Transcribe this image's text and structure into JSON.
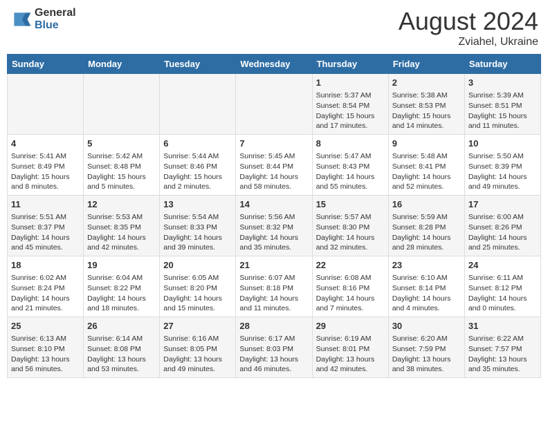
{
  "header": {
    "logo_general": "General",
    "logo_blue": "Blue",
    "month_year": "August 2024",
    "location": "Zviahel, Ukraine"
  },
  "days_of_week": [
    "Sunday",
    "Monday",
    "Tuesday",
    "Wednesday",
    "Thursday",
    "Friday",
    "Saturday"
  ],
  "weeks": [
    [
      {
        "day": "",
        "text": ""
      },
      {
        "day": "",
        "text": ""
      },
      {
        "day": "",
        "text": ""
      },
      {
        "day": "",
        "text": ""
      },
      {
        "day": "1",
        "text": "Sunrise: 5:37 AM\nSunset: 8:54 PM\nDaylight: 15 hours and 17 minutes."
      },
      {
        "day": "2",
        "text": "Sunrise: 5:38 AM\nSunset: 8:53 PM\nDaylight: 15 hours and 14 minutes."
      },
      {
        "day": "3",
        "text": "Sunrise: 5:39 AM\nSunset: 8:51 PM\nDaylight: 15 hours and 11 minutes."
      }
    ],
    [
      {
        "day": "4",
        "text": "Sunrise: 5:41 AM\nSunset: 8:49 PM\nDaylight: 15 hours and 8 minutes."
      },
      {
        "day": "5",
        "text": "Sunrise: 5:42 AM\nSunset: 8:48 PM\nDaylight: 15 hours and 5 minutes."
      },
      {
        "day": "6",
        "text": "Sunrise: 5:44 AM\nSunset: 8:46 PM\nDaylight: 15 hours and 2 minutes."
      },
      {
        "day": "7",
        "text": "Sunrise: 5:45 AM\nSunset: 8:44 PM\nDaylight: 14 hours and 58 minutes."
      },
      {
        "day": "8",
        "text": "Sunrise: 5:47 AM\nSunset: 8:43 PM\nDaylight: 14 hours and 55 minutes."
      },
      {
        "day": "9",
        "text": "Sunrise: 5:48 AM\nSunset: 8:41 PM\nDaylight: 14 hours and 52 minutes."
      },
      {
        "day": "10",
        "text": "Sunrise: 5:50 AM\nSunset: 8:39 PM\nDaylight: 14 hours and 49 minutes."
      }
    ],
    [
      {
        "day": "11",
        "text": "Sunrise: 5:51 AM\nSunset: 8:37 PM\nDaylight: 14 hours and 45 minutes."
      },
      {
        "day": "12",
        "text": "Sunrise: 5:53 AM\nSunset: 8:35 PM\nDaylight: 14 hours and 42 minutes."
      },
      {
        "day": "13",
        "text": "Sunrise: 5:54 AM\nSunset: 8:33 PM\nDaylight: 14 hours and 39 minutes."
      },
      {
        "day": "14",
        "text": "Sunrise: 5:56 AM\nSunset: 8:32 PM\nDaylight: 14 hours and 35 minutes."
      },
      {
        "day": "15",
        "text": "Sunrise: 5:57 AM\nSunset: 8:30 PM\nDaylight: 14 hours and 32 minutes."
      },
      {
        "day": "16",
        "text": "Sunrise: 5:59 AM\nSunset: 8:28 PM\nDaylight: 14 hours and 28 minutes."
      },
      {
        "day": "17",
        "text": "Sunrise: 6:00 AM\nSunset: 8:26 PM\nDaylight: 14 hours and 25 minutes."
      }
    ],
    [
      {
        "day": "18",
        "text": "Sunrise: 6:02 AM\nSunset: 8:24 PM\nDaylight: 14 hours and 21 minutes."
      },
      {
        "day": "19",
        "text": "Sunrise: 6:04 AM\nSunset: 8:22 PM\nDaylight: 14 hours and 18 minutes."
      },
      {
        "day": "20",
        "text": "Sunrise: 6:05 AM\nSunset: 8:20 PM\nDaylight: 14 hours and 15 minutes."
      },
      {
        "day": "21",
        "text": "Sunrise: 6:07 AM\nSunset: 8:18 PM\nDaylight: 14 hours and 11 minutes."
      },
      {
        "day": "22",
        "text": "Sunrise: 6:08 AM\nSunset: 8:16 PM\nDaylight: 14 hours and 7 minutes."
      },
      {
        "day": "23",
        "text": "Sunrise: 6:10 AM\nSunset: 8:14 PM\nDaylight: 14 hours and 4 minutes."
      },
      {
        "day": "24",
        "text": "Sunrise: 6:11 AM\nSunset: 8:12 PM\nDaylight: 14 hours and 0 minutes."
      }
    ],
    [
      {
        "day": "25",
        "text": "Sunrise: 6:13 AM\nSunset: 8:10 PM\nDaylight: 13 hours and 56 minutes."
      },
      {
        "day": "26",
        "text": "Sunrise: 6:14 AM\nSunset: 8:08 PM\nDaylight: 13 hours and 53 minutes."
      },
      {
        "day": "27",
        "text": "Sunrise: 6:16 AM\nSunset: 8:05 PM\nDaylight: 13 hours and 49 minutes."
      },
      {
        "day": "28",
        "text": "Sunrise: 6:17 AM\nSunset: 8:03 PM\nDaylight: 13 hours and 46 minutes."
      },
      {
        "day": "29",
        "text": "Sunrise: 6:19 AM\nSunset: 8:01 PM\nDaylight: 13 hours and 42 minutes."
      },
      {
        "day": "30",
        "text": "Sunrise: 6:20 AM\nSunset: 7:59 PM\nDaylight: 13 hours and 38 minutes."
      },
      {
        "day": "31",
        "text": "Sunrise: 6:22 AM\nSunset: 7:57 PM\nDaylight: 13 hours and 35 minutes."
      }
    ]
  ]
}
